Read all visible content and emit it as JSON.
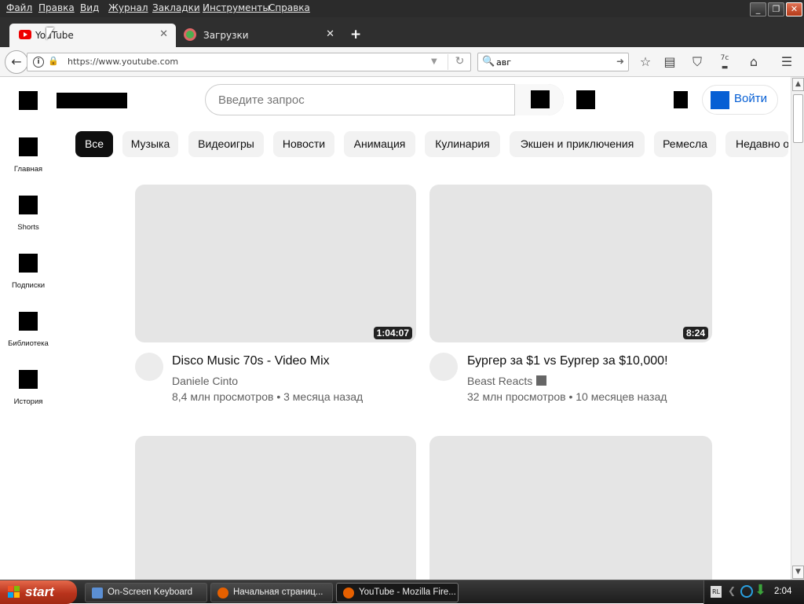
{
  "menubar": {
    "items": [
      "Файл",
      "Правка",
      "Вид",
      "Журнал",
      "Закладки",
      "Инструменты",
      "Справка"
    ],
    "window_controls": {
      "minimize": "_",
      "restore": "❐",
      "close": "✕"
    }
  },
  "tabs": [
    {
      "title": "YouTube",
      "icon": "youtube-icon",
      "active": true
    },
    {
      "title": "Загрузки",
      "icon": "downloads-icon",
      "active": false
    }
  ],
  "newtab_label": "+",
  "navbar": {
    "url": "https://www.youtube.com",
    "search_text": "авг",
    "back_icon": "←",
    "reload_icon": "↻",
    "addon_badge": "7c"
  },
  "youtube": {
    "search_placeholder": "Введите запрос",
    "login_label": "Войти",
    "sidebar": [
      {
        "label": "Главная"
      },
      {
        "label": "Shorts"
      },
      {
        "label": "Подписки"
      },
      {
        "label": "Библиотека"
      },
      {
        "label": "История"
      }
    ],
    "chips": [
      {
        "label": "Все",
        "active": true
      },
      {
        "label": "Музыка"
      },
      {
        "label": "Видеоигры"
      },
      {
        "label": "Новости"
      },
      {
        "label": "Анимация"
      },
      {
        "label": "Кулинария"
      },
      {
        "label": "Экшен и приключения"
      },
      {
        "label": "Ремесла"
      },
      {
        "label": "Недавно о"
      }
    ],
    "videos": [
      {
        "duration": "1:04:07",
        "title": "Disco Music 70s - Video Mix",
        "channel": "Daniele Cinto",
        "verified": false,
        "meta": "8,4 млн просмотров • 3 месяца назад"
      },
      {
        "duration": "8:24",
        "title": "Бургер за $1 vs Бургер за $10,000!",
        "channel": "Beast Reacts",
        "verified": true,
        "meta": "32 млн просмотров • 10 месяцев назад"
      }
    ]
  },
  "taskbar": {
    "start_label": "start",
    "tasks": [
      {
        "label": "On-Screen Keyboard",
        "active": false
      },
      {
        "label": "Начальная страниц...",
        "active": false
      },
      {
        "label": "YouTube - Mozilla Fire...",
        "active": true
      }
    ],
    "tray": {
      "lang": "RL",
      "clock": "2:04"
    }
  },
  "colors": {
    "accent_blue": "#065fd4",
    "youtube_red": "#ff0000",
    "start_red": "#c0391c"
  }
}
